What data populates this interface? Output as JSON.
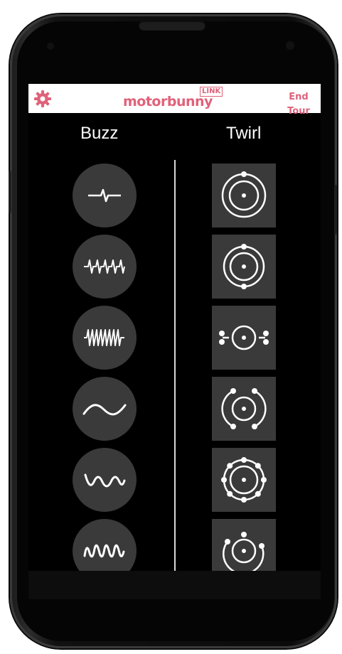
{
  "app": {
    "logo_text": "motorbunny",
    "logo_badge": "LINK",
    "end_tour": "End Tour"
  },
  "columns": {
    "buzz_title": "Buzz",
    "twirl_title": "Twirl"
  },
  "buzz_patterns": [
    {
      "icon": "single-pulse-waveform-icon"
    },
    {
      "icon": "pulse-train-waveform-icon"
    },
    {
      "icon": "dense-pulse-waveform-icon"
    },
    {
      "icon": "sine-wave-icon"
    },
    {
      "icon": "fast-wave-icon"
    },
    {
      "icon": "faster-wave-icon"
    }
  ],
  "twirl_patterns": [
    {
      "icon": "orbit-top-bottom-icon"
    },
    {
      "icon": "orbit-top-bottom-small-icon"
    },
    {
      "icon": "orbit-left-right-icon"
    },
    {
      "icon": "orbit-arcs-icon"
    },
    {
      "icon": "orbit-ring-dots-icon"
    },
    {
      "icon": "orbit-sweep-icon"
    }
  ],
  "colors": {
    "accent": "#e0627a",
    "tile": "#3a3a3a",
    "background": "#000000"
  }
}
